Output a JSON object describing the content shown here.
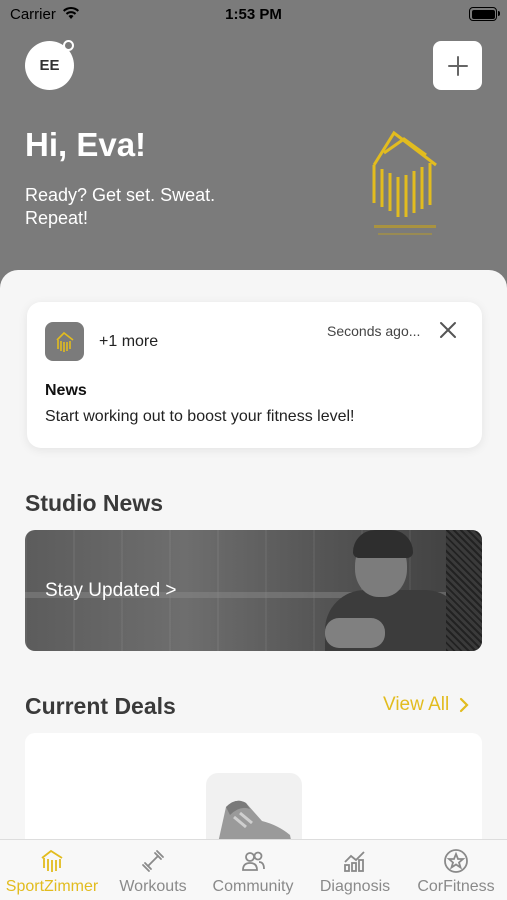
{
  "status_bar": {
    "carrier": "Carrier",
    "time": "1:53 PM"
  },
  "header": {
    "avatar_initials": "EE",
    "greeting": "Hi, Eva!",
    "tagline": "Ready? Get set. Sweat. Repeat!"
  },
  "notification": {
    "more": "+1 more",
    "time_ago": "Seconds ago...",
    "title": "News",
    "body": "Start working out to boost your fitness level!"
  },
  "studio_news": {
    "title": "Studio News",
    "cta": "Stay Updated >"
  },
  "deals": {
    "title": "Current Deals",
    "view_all": "View All"
  },
  "tabs": [
    {
      "label": "SportZimmer",
      "icon": "brand-icon",
      "active": true
    },
    {
      "label": "Workouts",
      "icon": "dumbbell-icon",
      "active": false
    },
    {
      "label": "Community",
      "icon": "people-icon",
      "active": false
    },
    {
      "label": "Diagnosis",
      "icon": "chart-icon",
      "active": false
    },
    {
      "label": "CorFitness",
      "icon": "star-icon",
      "active": false
    }
  ],
  "colors": {
    "accent": "#e2bc1f",
    "header_bg": "#7b7b7b",
    "sheet_bg": "#f6f6f6"
  }
}
